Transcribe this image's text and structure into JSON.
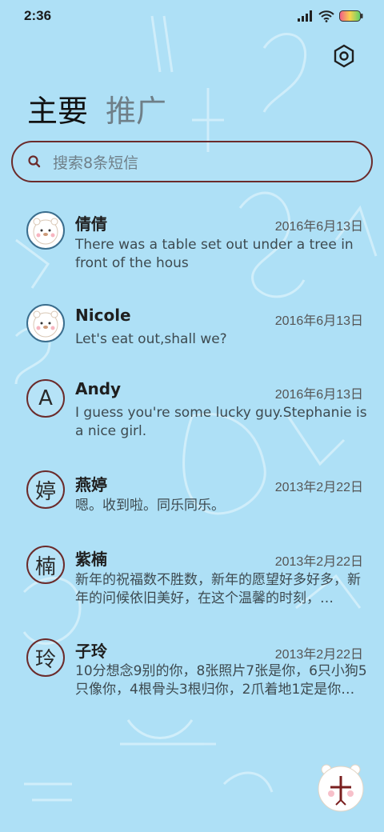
{
  "status": {
    "time": "2:36"
  },
  "tabs": [
    {
      "label": "主要",
      "active": true
    },
    {
      "label": "推广",
      "active": false
    }
  ],
  "search": {
    "placeholder": "搜索8条短信"
  },
  "conversations": [
    {
      "name": "倩倩",
      "date": "2016年6月13日",
      "message": "There was a table set out under a tree in front of the hous",
      "avatar": "bear-photo"
    },
    {
      "name": "Nicole",
      "date": "2016年6月13日",
      "message": "Let's eat out,shall we?",
      "avatar": "bear-photo"
    },
    {
      "name": "Andy",
      "date": "2016年6月13日",
      "message": "I guess you're some lucky guy.Stephanie is a nice girl.",
      "avatar_letter": "A"
    },
    {
      "name": "燕婷",
      "date": "2013年2月22日",
      "message": "嗯。收到啦。同乐同乐。",
      "avatar_letter": "婷"
    },
    {
      "name": "紫楠",
      "date": "2013年2月22日",
      "message": "新年的祝福数不胜数，新年的愿望好多好多，新年的问候依旧美好，在这个温馨的时刻，…",
      "avatar_letter": "楠"
    },
    {
      "name": "子玲",
      "date": "2013年2月22日",
      "message": "10分想念9别的你，8张照片7张是你，6只小狗5只像你，4根骨头3根归你，2爪着地1定是你…",
      "avatar_letter": "玲"
    }
  ],
  "colors": {
    "background": "#aee0f6",
    "accent": "#6b2b2b"
  }
}
